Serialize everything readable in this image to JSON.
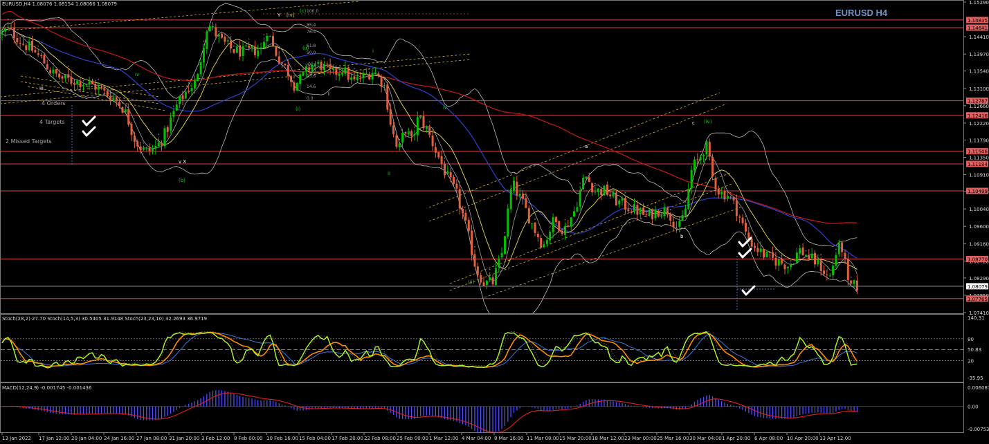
{
  "header": {
    "main_info": "EURUSD,H4  1.08076 1.08154 1.08066 1.08079",
    "stoch_info": "Stoch(28,2) 27.70  Stoch(14,5,3) 30.5405 31.9148  Stoch(23,23,10) 32.2693 36.9719",
    "macd_info": "MACD(12,24,9) -0.001745 -0.001436",
    "symbol_title": "EURUSD H4"
  },
  "annotations": {
    "orders": "4 Orders",
    "targets": "4 Targets",
    "missed": "2 Missed Targets"
  },
  "colors": {
    "background": "#000000",
    "bull": "#00c000",
    "bear": "#e06040",
    "hline": "#d04848",
    "ma_red": "#c81818",
    "ma_blue": "#3040d0",
    "ma_yellow": "#d8c848",
    "channel": "#d8b030",
    "bollinger": "#bcbcbc",
    "stoch_green": "#a8f028",
    "stoch_orange": "#ff8c00",
    "stoch_blue": "#3c78d8",
    "macd_line": "#e02020",
    "macd_hist": "#5050ff",
    "price_tag": "#e06060"
  },
  "chart_data": [
    {
      "type": "candlestick",
      "title": "EURUSD H4",
      "x_ticks": [
        "13 Jan 2022",
        "17 Jan 12:00",
        "20 Jan 04:00",
        "24 Jan 16:00",
        "27 Jan 08:00",
        "31 Jan 20:00",
        "3 Feb 12:00",
        "8 Feb 00:00",
        "10 Feb 16:00",
        "15 Feb 04:00",
        "17 Feb 20:00",
        "22 Feb 08:00",
        "25 Feb 00:00",
        "1 Mar 12:00",
        "4 Mar 04:00",
        "8 Mar 16:00",
        "11 Mar 08:00",
        "15 Mar 20:00",
        "18 Mar 12:00",
        "23 Mar 00:00",
        "25 Mar 16:00",
        "30 Mar 04:00",
        "1 Apr 20:00",
        "6 Apr 08:00",
        "10 Apr 20:00",
        "13 Apr 12:00"
      ],
      "y_ticks": [
        "1.15290",
        "1.14410",
        "1.13970",
        "1.13540",
        "1.13100",
        "1.12660",
        "1.12220",
        "1.11790",
        "1.11350",
        "1.10910",
        "1.10480",
        "1.10040",
        "1.09600",
        "1.09160",
        "1.08720",
        "1.08290",
        "1.07850",
        "1.07410"
      ],
      "ylim": [
        1.0741,
        1.1529
      ],
      "level_labels": [
        "1.14835",
        "1.14641",
        "1.12787",
        "1.12416",
        "1.11506",
        "1.11184",
        "1.10499",
        "1.08770",
        "1.08079",
        "1.07765"
      ],
      "levels": [
        1.14835,
        1.14641,
        1.12787,
        1.12416,
        1.11506,
        1.11184,
        1.10499,
        1.0877,
        1.07765
      ],
      "current_price": 1.08079,
      "close_path": [
        [
          0,
          1.1442
        ],
        [
          10,
          1.1462
        ],
        [
          20,
          1.1448
        ],
        [
          32,
          1.1425
        ],
        [
          45,
          1.141
        ],
        [
          60,
          1.1385
        ],
        [
          75,
          1.135
        ],
        [
          90,
          1.1335
        ],
        [
          105,
          1.133
        ],
        [
          120,
          1.1325
        ],
        [
          135,
          1.1318
        ],
        [
          150,
          1.13
        ],
        [
          165,
          1.1285
        ],
        [
          180,
          1.1255
        ],
        [
          195,
          1.118
        ],
        [
          205,
          1.1155
        ],
        [
          215,
          1.115
        ],
        [
          228,
          1.1165
        ],
        [
          240,
          1.12
        ],
        [
          255,
          1.1265
        ],
        [
          270,
          1.1305
        ],
        [
          285,
          1.133
        ],
        [
          292,
          1.1405
        ],
        [
          300,
          1.1475
        ],
        [
          310,
          1.1452
        ],
        [
          320,
          1.143
        ],
        [
          335,
          1.1408
        ],
        [
          350,
          1.1402
        ],
        [
          365,
          1.1405
        ],
        [
          378,
          1.141
        ],
        [
          386,
          1.146
        ],
        [
          395,
          1.1412
        ],
        [
          405,
          1.138
        ],
        [
          415,
          1.1355
        ],
        [
          425,
          1.132
        ],
        [
          435,
          1.1335
        ],
        [
          450,
          1.137
        ],
        [
          465,
          1.1368
        ],
        [
          480,
          1.1345
        ],
        [
          495,
          1.136
        ],
        [
          510,
          1.1325
        ],
        [
          525,
          1.134
        ],
        [
          540,
          1.1355
        ],
        [
          555,
          1.132
        ],
        [
          565,
          1.1215
        ],
        [
          575,
          1.1145
        ],
        [
          585,
          1.121
        ],
        [
          595,
          1.1175
        ],
        [
          605,
          1.124
        ],
        [
          618,
          1.12
        ],
        [
          630,
          1.115
        ],
        [
          645,
          1.109
        ],
        [
          660,
          1.104
        ],
        [
          675,
          1.095
        ],
        [
          688,
          1.085
        ],
        [
          700,
          1.0815
        ],
        [
          712,
          1.0818
        ],
        [
          725,
          1.089
        ],
        [
          740,
          1.107
        ],
        [
          755,
          1.102
        ],
        [
          770,
          1.096
        ],
        [
          785,
          1.091
        ],
        [
          800,
          1.0975
        ],
        [
          815,
          1.095
        ],
        [
          830,
          1.1
        ],
        [
          845,
          1.109
        ],
        [
          860,
          1.105
        ],
        [
          875,
          1.105
        ],
        [
          890,
          1.1025
        ],
        [
          905,
          1.101
        ],
        [
          920,
          1.1
        ],
        [
          935,
          1.0985
        ],
        [
          950,
          1.1
        ],
        [
          965,
          1.1
        ],
        [
          980,
          1.095
        ],
        [
          990,
          1.1
        ],
        [
          1000,
          1.111
        ],
        [
          1010,
          1.113
        ],
        [
          1020,
          1.117
        ],
        [
          1030,
          1.108
        ],
        [
          1040,
          1.1045
        ],
        [
          1052,
          1.104
        ],
        [
          1065,
          1.1
        ],
        [
          1080,
          1.093
        ],
        [
          1095,
          1.09
        ],
        [
          1110,
          1.088
        ],
        [
          1125,
          1.087
        ],
        [
          1140,
          1.086
        ],
        [
          1155,
          1.09
        ],
        [
          1170,
          1.088
        ],
        [
          1185,
          1.086
        ],
        [
          1198,
          1.0825
        ],
        [
          1210,
          1.0905
        ],
        [
          1218,
          1.0905
        ],
        [
          1225,
          1.081
        ],
        [
          1238,
          1.0808
        ]
      ]
    },
    {
      "type": "line",
      "title": "Stochastic",
      "y_ticks": [
        "140.31",
        "80",
        "50.83",
        "20",
        "-35.95"
      ],
      "levels": [
        80,
        50,
        20
      ],
      "ylim": [
        -35.95,
        140.31
      ],
      "series": [
        {
          "name": "Stoch(28,2)",
          "value": 27.7
        },
        {
          "name": "Stoch(14,5,3)",
          "values": [
            30.5405,
            31.9148
          ]
        },
        {
          "name": "Stoch(23,23,10)",
          "values": [
            32.2693,
            36.9719
          ]
        }
      ]
    },
    {
      "type": "bar",
      "title": "MACD(12,24,9)",
      "y_ticks": [
        "0.006087",
        "0.00",
        "-0.007533"
      ],
      "ylim": [
        -0.007533,
        0.006087
      ],
      "macd": -0.001745,
      "signal": -0.001436
    }
  ]
}
